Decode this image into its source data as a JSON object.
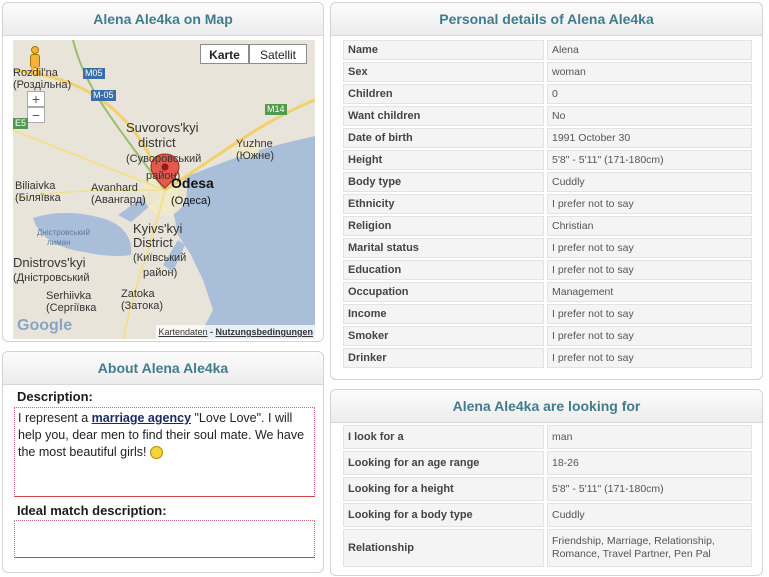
{
  "map_panel": {
    "title": "Alena Ale4ka on Map",
    "buttons": {
      "karte": "Karte",
      "satellit": "Satellit"
    },
    "zoom": {
      "in": "+",
      "out": "−"
    },
    "labels": {
      "rozdilna_1": "Rozdil'na",
      "rozdilna_2": "(Роздільна)",
      "suvorovskyi_1": "Suvorovs'kyi",
      "suvorovskyi_2": "district",
      "suvorovskyi_3": "(Суворовський",
      "suvorovskyi_4": "район)",
      "yuzhne_1": "Yuzhne",
      "yuzhne_2": "(Южне)",
      "odesa_1": "Odesa",
      "odesa_2": "(Одеса)",
      "avanhard_1": "Avanhard",
      "avanhard_2": "(Авангард)",
      "biliaivka_1": "Biliaivka",
      "biliaivka_2": "(Біляївка",
      "kyivskyi_1": "Kyivs'kyi",
      "kyivskyi_2": "District",
      "kyivskyi_3": "(Київський",
      "kyivskyi_4": "район)",
      "dnistrovskyi_1": "Dnistrovs'kyi",
      "dnistrovskyi_2": "(Дністровський",
      "serhiivka_1": "Serhiivka",
      "serhiivka_2": "(Сергіївка",
      "zatoka_1": "Zatoka",
      "zatoka_2": "(Затока)",
      "liman_1": "Дністровський",
      "liman_2": "лиман"
    },
    "roads": {
      "m05a": "M05",
      "m05b": "M-05",
      "m14": "M14",
      "e5": "E5"
    },
    "footer": {
      "kartendaten": "Kartendaten",
      "sep": " - ",
      "nutzung": "Nutzungsbedingungen"
    },
    "google": "Google"
  },
  "about_panel": {
    "title": "About Alena Ale4ka",
    "description_label": "Description:",
    "description_pre": "I represent a ",
    "description_link": "marriage agency",
    "description_post": " \"Love Love\". I will help you, dear men to find their soul mate. We have the most beautiful girls! ",
    "ideal_label": "Ideal match description:"
  },
  "details": {
    "title": "Personal details of Alena Ale4ka",
    "rows": [
      {
        "label": "Name",
        "value": "Alena"
      },
      {
        "label": "Sex",
        "value": "woman"
      },
      {
        "label": "Children",
        "value": "0"
      },
      {
        "label": "Want children",
        "value": "No"
      },
      {
        "label": "Date of birth",
        "value": "1991 October 30"
      },
      {
        "label": "Height",
        "value": "5'8\" - 5'11\" (171-180cm)"
      },
      {
        "label": "Body type",
        "value": "Cuddly"
      },
      {
        "label": "Ethnicity",
        "value": "I prefer not to say"
      },
      {
        "label": "Religion",
        "value": "Christian"
      },
      {
        "label": "Marital status",
        "value": "I prefer not to say"
      },
      {
        "label": "Education",
        "value": "I prefer not to say"
      },
      {
        "label": "Occupation",
        "value": "Management"
      },
      {
        "label": "Income",
        "value": "I prefer not to say"
      },
      {
        "label": "Smoker",
        "value": "I prefer not to say"
      },
      {
        "label": "Drinker",
        "value": "I prefer not to say"
      }
    ]
  },
  "looking": {
    "title": "Alena Ale4ka are looking for",
    "rows": [
      {
        "label": "I look for a",
        "value": "man"
      },
      {
        "label": "Looking for an age range",
        "value": "18-26"
      },
      {
        "label": "Looking for a height",
        "value": "5'8\" - 5'11\" (171-180cm)"
      },
      {
        "label": "Looking for a body type",
        "value": "Cuddly"
      },
      {
        "label": "Relationship",
        "value": "Friendship, Marriage, Relationship, Romance, Travel Partner, Pen Pal"
      }
    ]
  },
  "colors": {
    "accent": "#3f7d8e",
    "sea": "#a9bfd9",
    "land": "#e8e4da"
  }
}
